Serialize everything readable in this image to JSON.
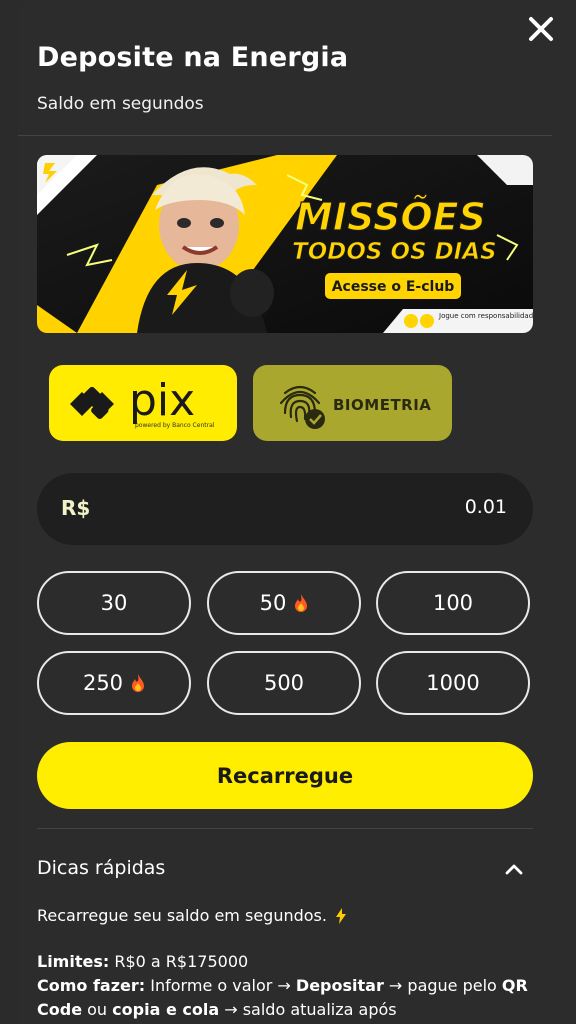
{
  "header": {
    "title": "Deposite na Energia",
    "subtitle": "Saldo em segundos",
    "close_icon": "close-icon"
  },
  "banner": {
    "headline_1": "MISSÕES",
    "headline_2": "TODOS OS DIAS",
    "cta_label": "Acesse o E-club",
    "footer_text": "Jogue com responsabilidade"
  },
  "payment_methods": [
    {
      "label": "pix",
      "sub": "powered by Banco Central",
      "icon": "pix-icon",
      "selected": true
    },
    {
      "label": "BIOMETRIA",
      "icon": "fingerprint-icon",
      "selected": false
    }
  ],
  "amount": {
    "currency": "R$",
    "value": "0.01"
  },
  "presets": [
    {
      "label": "30",
      "hot": false
    },
    {
      "label": "50",
      "hot": true
    },
    {
      "label": "100",
      "hot": false
    },
    {
      "label": "250",
      "hot": true
    },
    {
      "label": "500",
      "hot": false
    },
    {
      "label": "1000",
      "hot": false
    }
  ],
  "cta": {
    "label": "Recarregue"
  },
  "tips": {
    "title": "Dicas rápidas",
    "intro": "Recarregue seu saldo em segundos.",
    "limits_label": "Limites:",
    "limits_value": " R$0 a R$175000",
    "how_label": "Como fazer:",
    "how_text_1": " Informe o valor → ",
    "how_deposit": "Depositar",
    "how_text_2": " → pague pelo ",
    "how_qr": "QR Code",
    "how_text_3": " ou ",
    "how_copy": "copia e cola",
    "how_text_4": " → saldo atualiza após"
  },
  "colors": {
    "accent": "#ffee00",
    "biometria": "#aaa72f",
    "background": "#2c2c2c",
    "input_bg": "#1f1f1f"
  }
}
